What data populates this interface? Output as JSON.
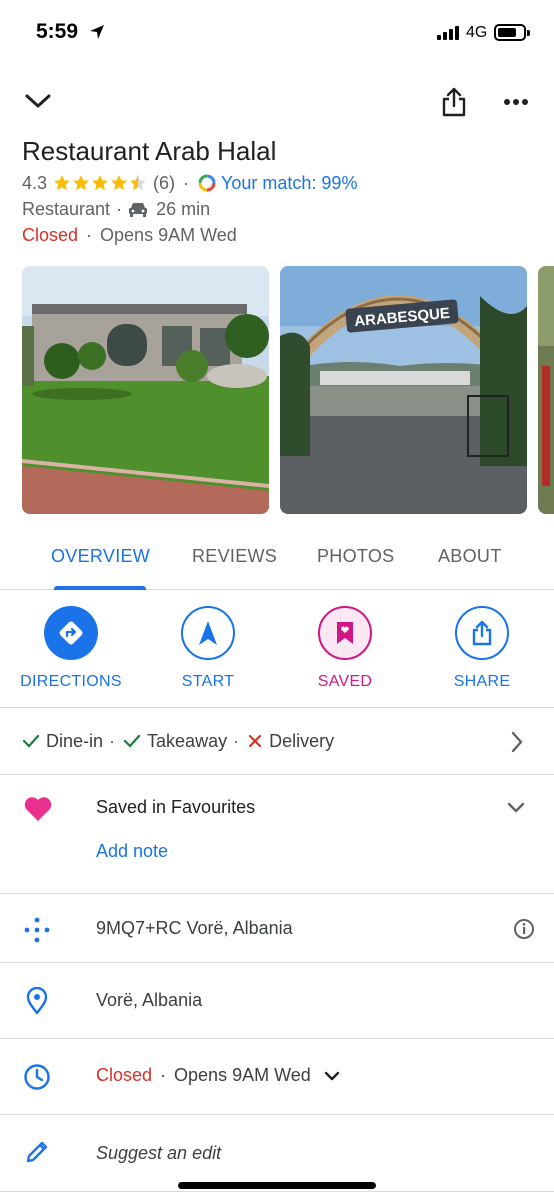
{
  "status_bar": {
    "time": "5:59",
    "network": "4G"
  },
  "place": {
    "name": "Restaurant Arab Halal",
    "rating": "4.3",
    "stars": 4.5,
    "review_count": "(6)",
    "dot": "·",
    "match": "Your match: 99%",
    "category": "Restaurant",
    "drive_time": "26 min",
    "status": "Closed",
    "opens": "Opens 9AM Wed"
  },
  "photo_sign": "ARABESQUE",
  "tabs": [
    {
      "label": "OVERVIEW",
      "active": true
    },
    {
      "label": "REVIEWS"
    },
    {
      "label": "PHOTOS"
    },
    {
      "label": "ABOUT"
    }
  ],
  "actions": [
    {
      "label": "DIRECTIONS"
    },
    {
      "label": "START"
    },
    {
      "label": "SAVED"
    },
    {
      "label": "SHARE"
    }
  ],
  "services": [
    {
      "label": "Dine-in",
      "available": true
    },
    {
      "label": "Takeaway",
      "available": true
    },
    {
      "label": "Delivery",
      "available": false
    }
  ],
  "saved": {
    "title": "Saved in Favourites",
    "add_note": "Add note"
  },
  "info": {
    "plus_code": "9MQ7+RC Vorë, Albania",
    "address": "Vorë, Albania",
    "hours_status": "Closed",
    "hours_opens": "Opens 9AM Wed",
    "suggest_edit": "Suggest an edit"
  },
  "colors": {
    "accent": "#1a73e8",
    "closed": "#d93025",
    "saved_pink": "#d01884",
    "star": "#fbbc04",
    "check": "#188038"
  }
}
